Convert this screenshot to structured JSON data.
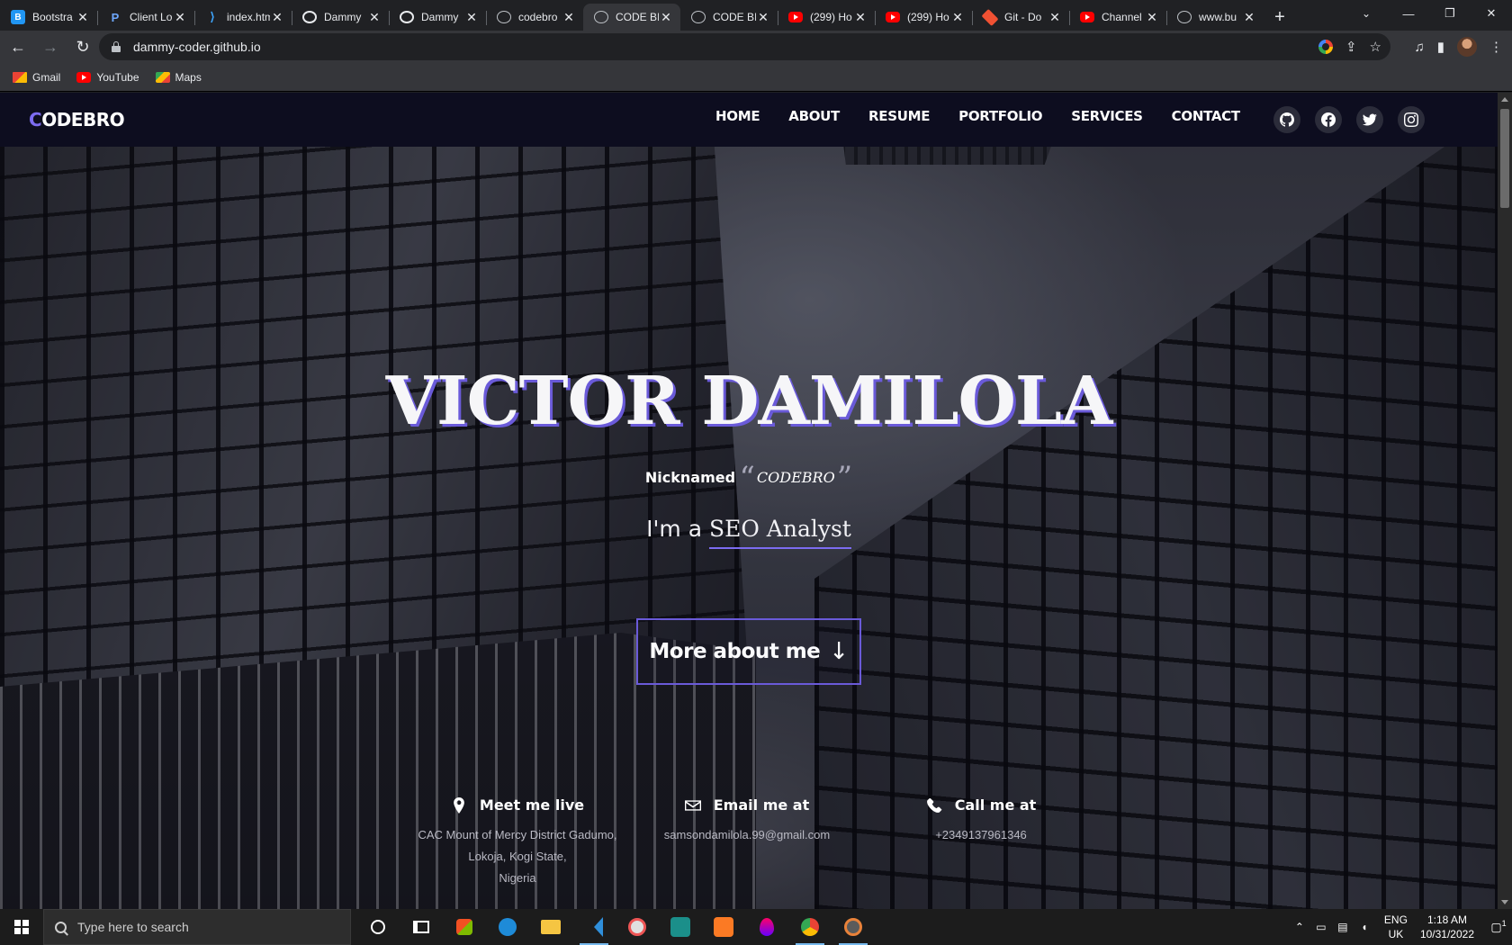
{
  "browser": {
    "tabs": [
      {
        "title": "Bootstra",
        "icon": "bootstrap-icon"
      },
      {
        "title": "Client Lo",
        "icon": "client-icon"
      },
      {
        "title": "index.htm",
        "icon": "vscode-icon"
      },
      {
        "title": "Dammy",
        "icon": "github-icon"
      },
      {
        "title": "Dammy",
        "icon": "github-icon"
      },
      {
        "title": "codebro",
        "icon": "globe-icon"
      },
      {
        "title": "CODE BI",
        "icon": "globe-icon",
        "active": true
      },
      {
        "title": "CODE BI",
        "icon": "globe-icon"
      },
      {
        "title": "(299) Ho",
        "icon": "youtube-icon"
      },
      {
        "title": "(299) Ho",
        "icon": "youtube-icon"
      },
      {
        "title": "Git - Do",
        "icon": "git-icon"
      },
      {
        "title": "Channel",
        "icon": "youtube-icon"
      },
      {
        "title": "www.bu",
        "icon": "globe-icon"
      }
    ],
    "new_tab": "+",
    "url": "dammy-coder.github.io",
    "bookmarks": [
      {
        "label": "Gmail",
        "icon": "gmail-icon"
      },
      {
        "label": "YouTube",
        "icon": "youtube-icon"
      },
      {
        "label": "Maps",
        "icon": "maps-icon"
      }
    ]
  },
  "site": {
    "logo_first": "C",
    "logo_rest": "ODEBRO",
    "nav": [
      "HOME",
      "ABOUT",
      "RESUME",
      "PORTFOLIO",
      "SERVICES",
      "CONTACT"
    ],
    "socials": [
      "github-icon",
      "facebook-icon",
      "twitter-icon",
      "instagram-icon"
    ],
    "accent_color": "#7c6cf0",
    "nav_bg": "#0d0d1f"
  },
  "hero": {
    "name": "VICTOR DAMILOLA",
    "nick_label": "Nicknamed",
    "open_quote": "“",
    "nickname": "CODEBRO",
    "close_quote": "”",
    "role_prefix": "I'm a ",
    "role": "SEO Analyst",
    "cta": "More about me",
    "cta_arrow": "↓"
  },
  "contact": {
    "live": {
      "title": "Meet me live",
      "lines": [
        "CAC Mount of Mercy District Gadumo,",
        "Lokoja, Kogi State,",
        "Nigeria"
      ]
    },
    "email": {
      "title": "Email me at",
      "value": "samsondamilola.99@gmail.com"
    },
    "call": {
      "title": "Call me at",
      "value": "+2349137961346"
    }
  },
  "taskbar": {
    "search_placeholder": "Type here to search",
    "lang_line1": "ENG",
    "lang_line2": "UK",
    "time": "1:18 AM",
    "date": "10/31/2022",
    "notifications": "1"
  }
}
